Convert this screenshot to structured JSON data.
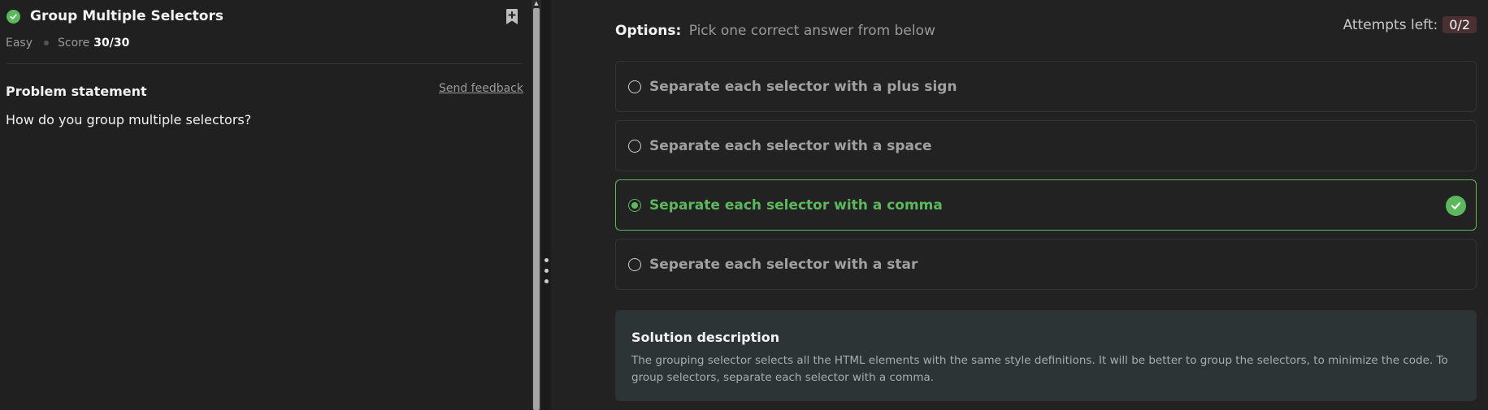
{
  "problem": {
    "title": "Group Multiple Selectors",
    "difficulty": "Easy",
    "score_label": "Score",
    "score": "30/30",
    "statement_heading": "Problem statement",
    "feedback_link": "Send feedback",
    "question": "How do you group multiple selectors?"
  },
  "options": {
    "label": "Options:",
    "hint": "Pick one correct answer from below",
    "attempts_label": "Attempts left:",
    "attempts_value": "0/2",
    "items": [
      {
        "text": "Separate each selector with a plus sign",
        "selected": false,
        "correct": false
      },
      {
        "text": "Separate each selector with a space",
        "selected": false,
        "correct": false
      },
      {
        "text": "Separate each selector with a comma",
        "selected": true,
        "correct": true
      },
      {
        "text": "Seperate each selector with a star",
        "selected": false,
        "correct": false
      }
    ]
  },
  "solution": {
    "title": "Solution description",
    "text": "The grouping selector selects all the HTML elements with the same style definitions. It will be better to group the selectors, to minimize the code. To group selectors, separate each selector with a comma."
  },
  "colors": {
    "success": "#5cb85c",
    "attempts_badge_bg": "#4a2f33",
    "solution_bg": "#2c3436"
  },
  "icons": {
    "solved": "check-circle-icon",
    "bookmark": "bookmark-add-icon",
    "correct": "check-circle-icon"
  }
}
